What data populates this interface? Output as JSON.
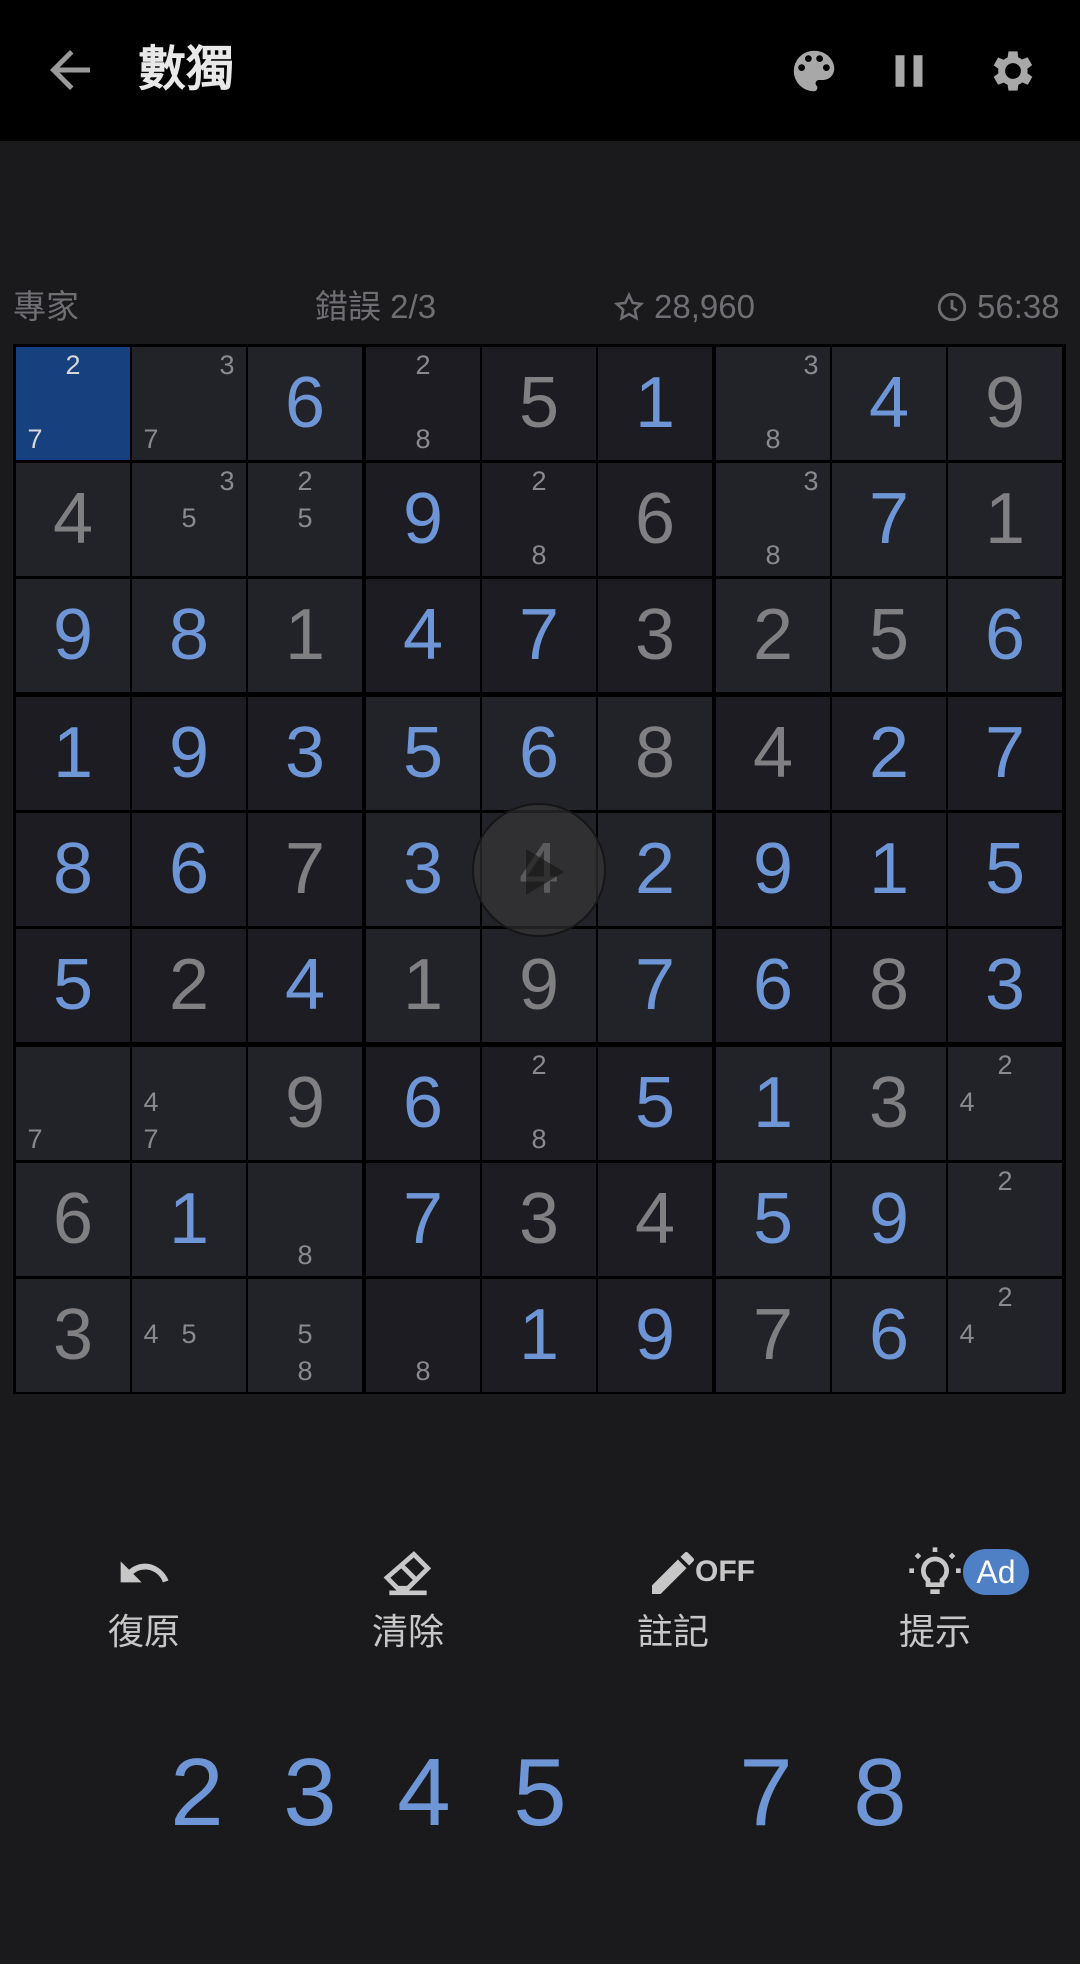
{
  "header": {
    "title": "數獨",
    "icons": [
      "back-arrow-icon",
      "palette-icon",
      "pause-icon",
      "gear-icon"
    ]
  },
  "info": {
    "difficulty": "專家",
    "mistakes": "錯誤 2/3",
    "score": "28,960",
    "timer": "56:38"
  },
  "colors": {
    "given": "#808082",
    "user": "#6e96d6",
    "highlight": "#17407e",
    "accent": "#4f7fc4"
  },
  "board": [
    [
      {
        "n": [
          2,
          7
        ]
      },
      {
        "n": [
          3,
          7
        ]
      },
      {
        "v": 6,
        "u": 1
      },
      {
        "n": [
          2,
          8
        ]
      },
      {
        "v": 5
      },
      {
        "v": 1,
        "u": 1
      },
      {
        "n": [
          3,
          8
        ]
      },
      {
        "v": 4,
        "u": 1
      },
      {
        "v": 9
      }
    ],
    [
      {
        "v": 4
      },
      {
        "n": [
          3,
          5
        ]
      },
      {
        "n": [
          2,
          5
        ]
      },
      {
        "v": 9,
        "u": 1
      },
      {
        "n": [
          2,
          8
        ]
      },
      {
        "v": 6
      },
      {
        "n": [
          3,
          8
        ]
      },
      {
        "v": 7,
        "u": 1
      },
      {
        "v": 1
      }
    ],
    [
      {
        "v": 9,
        "u": 1
      },
      {
        "v": 8,
        "u": 1
      },
      {
        "v": 1
      },
      {
        "v": 4,
        "u": 1
      },
      {
        "v": 7,
        "u": 1
      },
      {
        "v": 3
      },
      {
        "v": 2
      },
      {
        "v": 5
      },
      {
        "v": 6,
        "u": 1
      }
    ],
    [
      {
        "v": 1,
        "u": 1
      },
      {
        "v": 9,
        "u": 1
      },
      {
        "v": 3,
        "u": 1
      },
      {
        "v": 5,
        "u": 1
      },
      {
        "v": 6,
        "u": 1
      },
      {
        "v": 8
      },
      {
        "v": 4
      },
      {
        "v": 2,
        "u": 1
      },
      {
        "v": 7,
        "u": 1
      }
    ],
    [
      {
        "v": 8,
        "u": 1
      },
      {
        "v": 6,
        "u": 1
      },
      {
        "v": 7
      },
      {
        "v": 3,
        "u": 1
      },
      {
        "v": 4
      },
      {
        "v": 2,
        "u": 1
      },
      {
        "v": 9,
        "u": 1
      },
      {
        "v": 1,
        "u": 1
      },
      {
        "v": 5,
        "u": 1
      }
    ],
    [
      {
        "v": 5,
        "u": 1
      },
      {
        "v": 2
      },
      {
        "v": 4,
        "u": 1
      },
      {
        "v": 1
      },
      {
        "v": 9
      },
      {
        "v": 7,
        "u": 1
      },
      {
        "v": 6,
        "u": 1
      },
      {
        "v": 8
      },
      {
        "v": 3,
        "u": 1
      }
    ],
    [
      {
        "n": [
          7
        ]
      },
      {
        "n": [
          4,
          7
        ]
      },
      {
        "v": 9
      },
      {
        "v": 6,
        "u": 1
      },
      {
        "n": [
          2,
          8
        ]
      },
      {
        "v": 5,
        "u": 1
      },
      {
        "v": 1,
        "u": 1
      },
      {
        "v": 3
      },
      {
        "n": [
          2,
          4
        ]
      }
    ],
    [
      {
        "v": 6
      },
      {
        "v": 1,
        "u": 1
      },
      {
        "n": [
          8
        ]
      },
      {
        "v": 7,
        "u": 1
      },
      {
        "v": 3
      },
      {
        "v": 4
      },
      {
        "v": 5,
        "u": 1
      },
      {
        "v": 9,
        "u": 1
      },
      {
        "n": [
          2
        ]
      }
    ],
    [
      {
        "v": 3
      },
      {
        "n": [
          4,
          5
        ]
      },
      {
        "n": [
          5,
          8
        ]
      },
      {
        "n": [
          8
        ]
      },
      {
        "v": 1,
        "u": 1
      },
      {
        "v": 9,
        "u": 1
      },
      {
        "v": 7
      },
      {
        "v": 6,
        "u": 1
      },
      {
        "n": [
          2,
          4
        ]
      }
    ]
  ],
  "selected": [
    0,
    0
  ],
  "toolbar": {
    "undo": "復原",
    "erase": "清除",
    "notes": "註記",
    "notes_state": "OFF",
    "hint": "提示",
    "hint_badge": "Ad"
  },
  "numpad": [
    "2",
    "3",
    "4",
    "5",
    "7",
    "8"
  ]
}
